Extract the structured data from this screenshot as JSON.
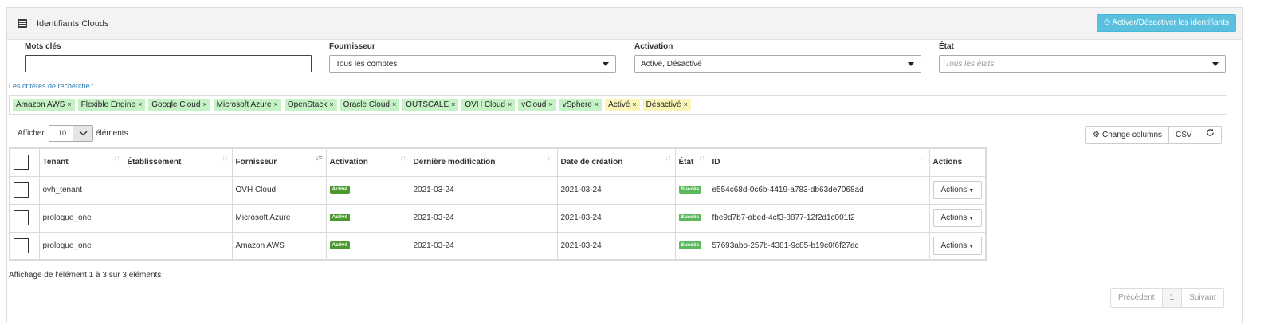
{
  "header": {
    "title": "Identifiants Clouds",
    "toggle_button": "Activer/Désactiver les identifiants"
  },
  "filters": {
    "keywords_label": "Mots clés",
    "keywords_value": "",
    "provider_label": "Fournisseur",
    "provider_value": "Tous les comptes",
    "activation_label": "Activation",
    "activation_value": "Activé, Désactivé",
    "state_label": "État",
    "state_placeholder": "Tous les états"
  },
  "criteria": {
    "label": "Les critères de recherche :",
    "tags": [
      {
        "label": "Amazon AWS",
        "color": "green"
      },
      {
        "label": "Flexible Engine",
        "color": "green"
      },
      {
        "label": "Google Cloud",
        "color": "green"
      },
      {
        "label": "Microsoft Azure",
        "color": "green"
      },
      {
        "label": "OpenStack",
        "color": "green"
      },
      {
        "label": "Oracle Cloud",
        "color": "green"
      },
      {
        "label": "OUTSCALE",
        "color": "green"
      },
      {
        "label": "OVH Cloud",
        "color": "green"
      },
      {
        "label": "vCloud",
        "color": "green"
      },
      {
        "label": "vSphere",
        "color": "green"
      },
      {
        "label": "Activé",
        "color": "yellow"
      },
      {
        "label": "Désactivé",
        "color": "yellow"
      }
    ]
  },
  "length_menu": {
    "show_label": "Afficher",
    "value": "10",
    "elements_label": "éléments"
  },
  "table_buttons": {
    "change_columns": "Change columns",
    "csv": "CSV"
  },
  "table": {
    "columns": [
      "Tenant",
      "Établissement",
      "Fornisseur",
      "Activation",
      "Dernière modification",
      "Date de création",
      "État",
      "ID",
      "Actions"
    ],
    "rows": [
      {
        "tenant": "ovh_tenant",
        "etablissement": "",
        "fournisseur": "OVH Cloud",
        "activation": "Activé",
        "modif": "2021-03-24",
        "creation": "2021-03-24",
        "etat": "Succès",
        "id": "e554c68d-0c6b-4419-a783-db63de7068ad",
        "actions": "Actions"
      },
      {
        "tenant": "prologue_one",
        "etablissement": "",
        "fournisseur": "Microsoft Azure",
        "activation": "Activé",
        "modif": "2021-03-24",
        "creation": "2021-03-24",
        "etat": "Succès",
        "id": "fbe9d7b7-abed-4cf3-8877-12f2d1c001f2",
        "actions": "Actions"
      },
      {
        "tenant": "prologue_one",
        "etablissement": "",
        "fournisseur": "Amazon AWS",
        "activation": "Activé",
        "modif": "2021-03-24",
        "creation": "2021-03-24",
        "etat": "Succès",
        "id": "57693abo-257b-4381-9c85-b19c0f6f27ac",
        "actions": "Actions"
      }
    ]
  },
  "info": "Affichage de l'élément 1 à 3 sur 3 éléments",
  "pagination": {
    "prev": "Précédent",
    "current": "1",
    "next": "Suivant"
  },
  "colors": {
    "accent": "#5bc0de",
    "tag_green": "#c5f2c5",
    "tag_yellow": "#fbf5b8",
    "badge_green": "#5cb85c"
  }
}
